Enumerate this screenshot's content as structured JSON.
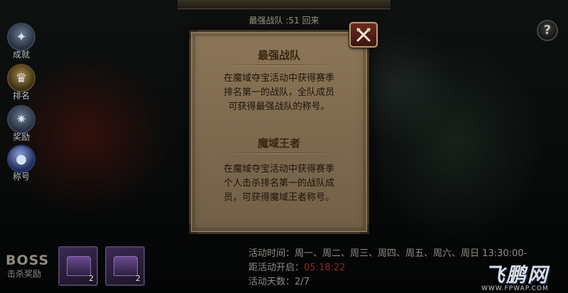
{
  "header": {
    "subtitle": "最强战队 :51 回来"
  },
  "sidebar": {
    "items": [
      {
        "label": "成就",
        "icon": "achievement-emblem-icon"
      },
      {
        "label": "排名",
        "icon": "ranking-emblem-icon"
      },
      {
        "label": "奖励",
        "icon": "reward-emblem-icon"
      },
      {
        "label": "称号",
        "icon": "title-orb-icon"
      }
    ]
  },
  "help": {
    "label": "?"
  },
  "dialog": {
    "sections": [
      {
        "title": "最强战队",
        "lines": [
          "在魔域夺宝活动中获得赛季",
          "排名第一的战队，全队成员",
          "可获得最强战队的称号。"
        ]
      },
      {
        "title": "魔域王者",
        "lines": [
          "在魔域夺宝活动中获得赛季",
          "个人击杀排名第一的战队成",
          "员，可获得魔域王者称号。"
        ]
      }
    ]
  },
  "bottom": {
    "boss_title": "BOSS",
    "boss_subtitle": "击杀奖励",
    "rewards": [
      {
        "count": "2"
      },
      {
        "count": "2"
      }
    ],
    "activity_time": "活动时间：周一、周二、周三、周四、周五、周六、周日 13:30:00-",
    "countdown_label": "距活动开启：",
    "countdown_value": "05:18:22",
    "days_label": "活动天数：2/7"
  },
  "watermark": {
    "logo": "飞鹏网",
    "url": "WWW.FPWAP.COM"
  },
  "colors": {
    "dialog_bg": "#7e6a4f",
    "dialog_title": "#3a2410",
    "close_button": "#6a2a1e",
    "countdown": "#8b2a22"
  }
}
